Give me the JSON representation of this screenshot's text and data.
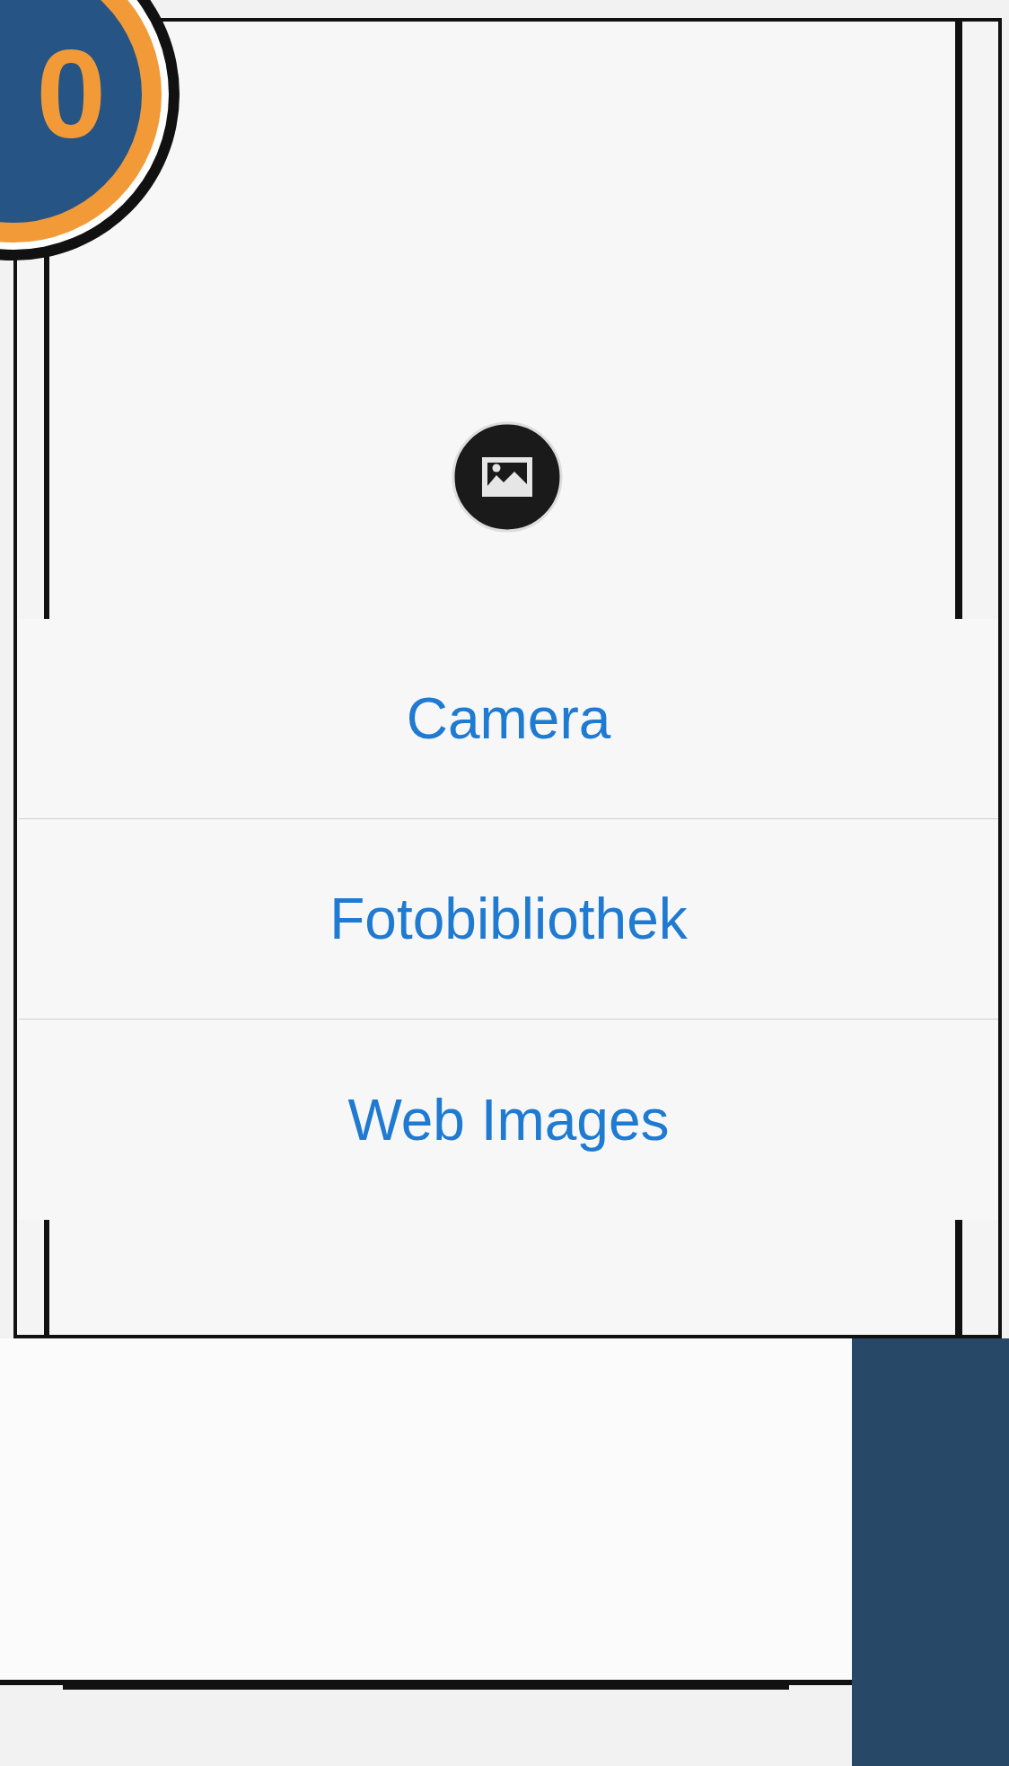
{
  "badge": {
    "text": "0"
  },
  "popover": {
    "items": [
      {
        "label": "Camera"
      },
      {
        "label": "Fotobibliothek"
      },
      {
        "label": "Web Images"
      }
    ]
  }
}
